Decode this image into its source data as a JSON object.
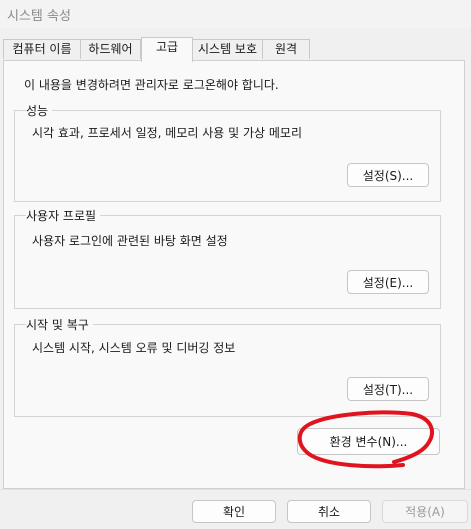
{
  "window": {
    "title": "시스템 속성"
  },
  "tabs": [
    {
      "label": "컴퓨터 이름"
    },
    {
      "label": "하드웨어"
    },
    {
      "label": "고급"
    },
    {
      "label": "시스템 보호"
    },
    {
      "label": "원격"
    }
  ],
  "active_tab": "고급",
  "notice": "이 내용을 변경하려면 관리자로 로그온해야 합니다.",
  "groups": [
    {
      "label": "성능",
      "description": "시각 효과, 프로세서 일정, 메모리 사용 및 가상 메모리",
      "button": "설정(S)..."
    },
    {
      "label": "사용자 프로필",
      "description": "사용자 로그인에 관련된 바탕 화면 설정",
      "button": "설정(E)..."
    },
    {
      "label": "시작 및 복구",
      "description": "시스템 시작, 시스템 오류 및 디버깅 정보",
      "button": "설정(T)..."
    }
  ],
  "env_button": "환경 변수(N)...",
  "footer": {
    "ok": "확인",
    "cancel": "취소",
    "apply": "적용(A)"
  },
  "annotation_color": "#e0141e"
}
